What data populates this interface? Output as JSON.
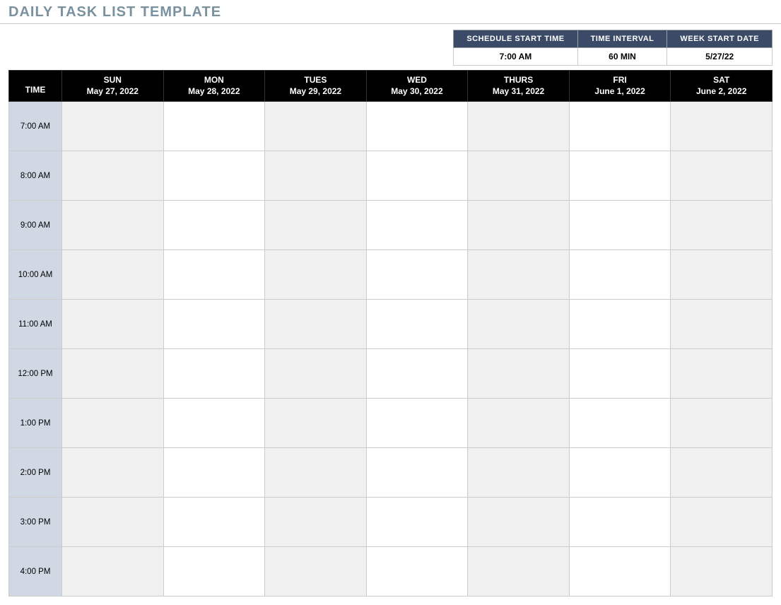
{
  "title": "DAILY TASK LIST TEMPLATE",
  "config": {
    "headers": {
      "start_time": "SCHEDULE START TIME",
      "interval": "TIME INTERVAL",
      "week_start": "WEEK START DATE"
    },
    "values": {
      "start_time": "7:00 AM",
      "interval": "60 MIN",
      "week_start": "5/27/22"
    }
  },
  "schedule": {
    "time_header": "TIME",
    "days": [
      {
        "label": "SUN",
        "date": "May 27, 2022"
      },
      {
        "label": "MON",
        "date": "May 28, 2022"
      },
      {
        "label": "TUES",
        "date": "May 29, 2022"
      },
      {
        "label": "WED",
        "date": "May 30, 2022"
      },
      {
        "label": "THURS",
        "date": "May 31, 2022"
      },
      {
        "label": "FRI",
        "date": "June 1, 2022"
      },
      {
        "label": "SAT",
        "date": "June 2, 2022"
      }
    ],
    "times": [
      "7:00 AM",
      "8:00 AM",
      "9:00 AM",
      "10:00 AM",
      "11:00 AM",
      "12:00 PM",
      "1:00 PM",
      "2:00 PM",
      "3:00 PM",
      "4:00 PM"
    ]
  }
}
